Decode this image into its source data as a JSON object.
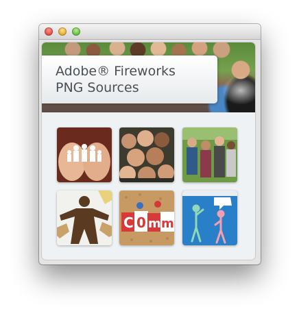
{
  "window": {
    "controls": [
      "close",
      "minimize",
      "zoom"
    ]
  },
  "banner": {
    "title_line1": "Adobe® Fireworks",
    "title_line2": "PNG Sources"
  },
  "thumbnails": [
    {
      "name": "paper-family-hands",
      "icon": "hands-paper-chain-image"
    },
    {
      "name": "group-of-young-people",
      "icon": "crowd-photo-image"
    },
    {
      "name": "students-on-grass",
      "icon": "students-photo-image"
    },
    {
      "name": "paper-people-chain",
      "icon": "paper-figures-image"
    },
    {
      "name": "corkboard-letters-comm",
      "icon": "corkboard-letters-image",
      "text": "C0mm"
    },
    {
      "name": "two-figures-blue",
      "icon": "figures-speech-image"
    }
  ]
}
